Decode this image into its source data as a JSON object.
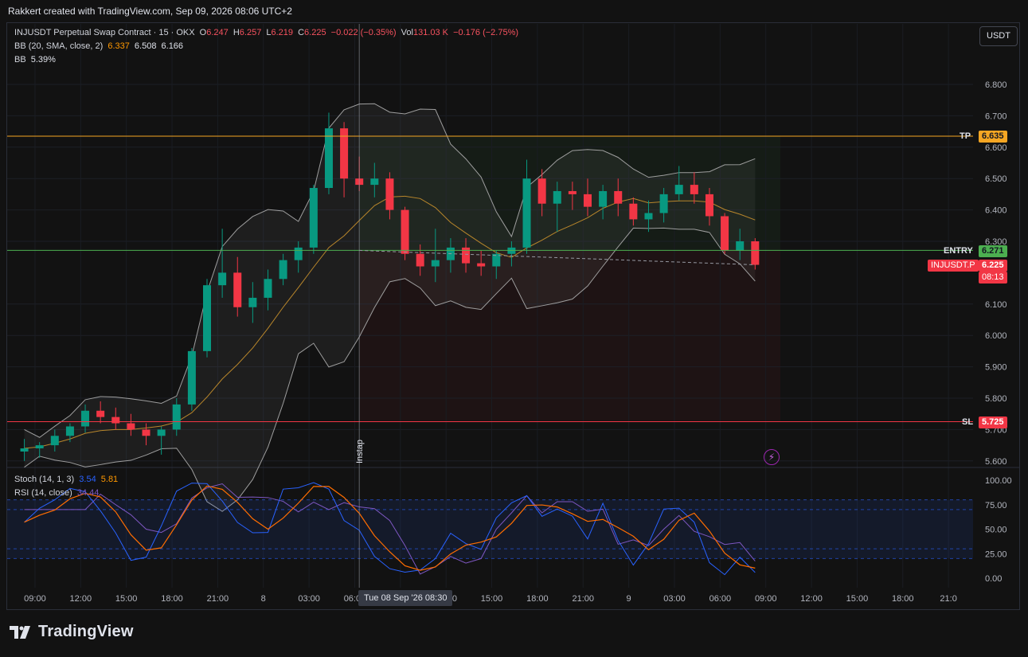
{
  "attribution": "Rakkert created with TradingView.com, Sep 09, 2026 08:06 UTC+2",
  "unit_button": "USDT",
  "brand": {
    "name": "TradingView",
    "icon": "tradingview-logo-icon"
  },
  "legend": {
    "symbol": "INJUSDT Perpetual Swap Contract · 15 · OKX",
    "o_label": "O",
    "o": "6.247",
    "h_label": "H",
    "h": "6.257",
    "l_label": "L",
    "l": "6.219",
    "c_label": "C",
    "c": "6.225",
    "change": "−0.022 (−0.35%)",
    "vol_label": "Vol",
    "vol": "131.03 K",
    "vol_change": "−0.176 (−2.75%)",
    "bb_label": "BB (20, SMA, close, 2)",
    "bb_mid": "6.337",
    "bb_upper": "6.508",
    "bb_lower": "6.166",
    "bbw_label": "BB",
    "bbw": "5.39%",
    "stoch_label": "Stoch (14, 1, 3)",
    "stoch_k": "3.54",
    "stoch_d": "5.81",
    "rsi_label": "RSI (14, close)",
    "rsi": "34.44"
  },
  "levels": {
    "tp_label": "TP",
    "tp": "6.635",
    "entry_label": "ENTRY",
    "entry": "6.271",
    "sl_label": "SL",
    "sl": "5.725",
    "symbol_tag": "INJUSDT.P",
    "last_price": "6.225",
    "countdown": "08:13"
  },
  "cursor": {
    "time_label": "Tue 08 Sep '26   08:30",
    "drawing_label": "Instap"
  },
  "colors": {
    "background": "#121212",
    "up": "#089981",
    "down": "#f23645",
    "tp": "#f5a623",
    "entry": "#4caf50",
    "sl": "#f23645",
    "bb_mid": "#b8862b",
    "bb_band": "#9e9e9e",
    "stoch_k": "#2962ff",
    "stoch_d": "#ff6d00",
    "rsi": "#7e57c2"
  },
  "chart_data": {
    "type": "candlestick",
    "price_axis": {
      "ticks": [
        "6.800",
        "6.700",
        "6.600",
        "6.500",
        "6.400",
        "6.300",
        "6.100",
        "6.000",
        "5.900",
        "5.800",
        "5.700",
        "5.600"
      ],
      "ylim": [
        5.58,
        6.83
      ]
    },
    "oscillator_axis": {
      "ticks": [
        "100.00",
        "75.00",
        "50.00",
        "25.00",
        "0.00"
      ],
      "ylim": [
        -5,
        105
      ],
      "bands": [
        20,
        80,
        30,
        70
      ]
    },
    "time_axis": {
      "ticks": [
        "09:00",
        "12:00",
        "15:00",
        "18:00",
        "21:00",
        "8",
        "03:00",
        "06:00",
        "09:00",
        "12:00",
        "15:00",
        "18:00",
        "21:00",
        "9",
        "03:00",
        "06:00",
        "09:00",
        "12:00",
        "15:00",
        "18:00",
        "21:0"
      ]
    },
    "candles_ohlc_by_hour": [
      [
        5.63,
        5.67,
        5.6,
        5.64
      ],
      [
        5.64,
        5.66,
        5.61,
        5.65
      ],
      [
        5.65,
        5.7,
        5.63,
        5.68
      ],
      [
        5.68,
        5.72,
        5.66,
        5.71
      ],
      [
        5.71,
        5.78,
        5.69,
        5.76
      ],
      [
        5.76,
        5.79,
        5.72,
        5.74
      ],
      [
        5.74,
        5.77,
        5.7,
        5.72
      ],
      [
        5.72,
        5.75,
        5.68,
        5.7
      ],
      [
        5.7,
        5.72,
        5.65,
        5.68
      ],
      [
        5.68,
        5.71,
        5.62,
        5.7
      ],
      [
        5.7,
        5.8,
        5.68,
        5.78
      ],
      [
        5.78,
        5.96,
        5.76,
        5.95
      ],
      [
        5.95,
        6.18,
        5.93,
        6.16
      ],
      [
        6.16,
        6.34,
        6.12,
        6.2
      ],
      [
        6.2,
        6.25,
        6.06,
        6.09
      ],
      [
        6.09,
        6.17,
        6.04,
        6.12
      ],
      [
        6.12,
        6.21,
        6.08,
        6.18
      ],
      [
        6.18,
        6.26,
        6.16,
        6.24
      ],
      [
        6.24,
        6.3,
        6.2,
        6.28
      ],
      [
        6.28,
        6.48,
        6.26,
        6.47
      ],
      [
        6.47,
        6.71,
        6.45,
        6.66
      ],
      [
        6.66,
        6.68,
        6.44,
        6.5
      ],
      [
        6.5,
        6.57,
        6.46,
        6.48
      ],
      [
        6.48,
        6.55,
        6.44,
        6.5
      ],
      [
        6.5,
        6.52,
        6.37,
        6.4
      ],
      [
        6.4,
        6.41,
        6.24,
        6.26
      ],
      [
        6.26,
        6.29,
        6.19,
        6.22
      ],
      [
        6.22,
        6.34,
        6.17,
        6.24
      ],
      [
        6.24,
        6.31,
        6.2,
        6.28
      ],
      [
        6.28,
        6.31,
        6.2,
        6.23
      ],
      [
        6.23,
        6.27,
        6.19,
        6.22
      ],
      [
        6.22,
        6.27,
        6.18,
        6.26
      ],
      [
        6.26,
        6.3,
        6.22,
        6.28
      ],
      [
        6.28,
        6.56,
        6.26,
        6.5
      ],
      [
        6.5,
        6.53,
        6.38,
        6.42
      ],
      [
        6.42,
        6.49,
        6.33,
        6.46
      ],
      [
        6.46,
        6.49,
        6.4,
        6.45
      ],
      [
        6.45,
        6.5,
        6.38,
        6.41
      ],
      [
        6.41,
        6.48,
        6.37,
        6.46
      ],
      [
        6.46,
        6.5,
        6.38,
        6.42
      ],
      [
        6.42,
        6.44,
        6.35,
        6.37
      ],
      [
        6.37,
        6.43,
        6.33,
        6.39
      ],
      [
        6.39,
        6.47,
        6.36,
        6.45
      ],
      [
        6.45,
        6.54,
        6.43,
        6.48
      ],
      [
        6.48,
        6.52,
        6.42,
        6.45
      ],
      [
        6.45,
        6.47,
        6.35,
        6.38
      ],
      [
        6.38,
        6.39,
        6.26,
        6.27
      ],
      [
        6.27,
        6.34,
        6.24,
        6.3
      ],
      [
        6.3,
        6.31,
        6.21,
        6.225
      ]
    ],
    "candle_hours_from_start": 48,
    "entry_drawing_start_hour": 22.5,
    "cursor_hour": 22.5
  }
}
